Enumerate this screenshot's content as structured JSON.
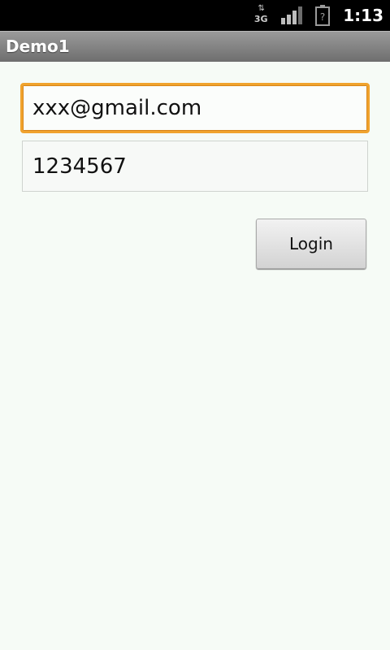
{
  "status_bar": {
    "network": "3G",
    "time": "1:13"
  },
  "app": {
    "title": "Demo1"
  },
  "form": {
    "email_value": "xxx@gmail.com",
    "password_value": "1234567",
    "login_label": "Login"
  },
  "icons": {
    "network": "network-3g-icon",
    "signal": "signal-strength-icon",
    "battery": "battery-unknown-icon"
  },
  "colors": {
    "focus_accent": "#f0a32d",
    "background": "#f6fbf6"
  }
}
